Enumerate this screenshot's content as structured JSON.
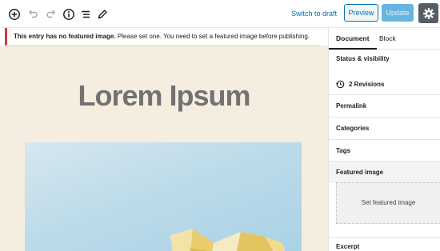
{
  "toolbar": {
    "icons": [
      "add-block-icon",
      "undo-icon",
      "redo-icon",
      "info-icon",
      "list-view-icon",
      "edit-pencil-icon"
    ],
    "switch_to_draft": "Switch to draft",
    "preview": "Preview",
    "update": "Update",
    "settings_icon": "gear-icon"
  },
  "notice": {
    "strong": "This entry has no featured image.",
    "text": " Please set one. You need to set a featured image before publishing."
  },
  "editor": {
    "title": "Lorem Ipsum",
    "background_color": "#f5eee0",
    "title_color": "#727272"
  },
  "sidebar": {
    "tabs": [
      {
        "label": "Document",
        "active": true
      },
      {
        "label": "Block",
        "active": false
      }
    ],
    "status_visibility": "Status & visibility",
    "revisions": "2 Revisions",
    "permalink": "Permalink",
    "categories": "Categories",
    "tags": "Tags",
    "featured_image": "Featured image",
    "set_featured_image": "Set featured image",
    "excerpt": "Excerpt"
  },
  "colors": {
    "accent": "#0073aa",
    "notice_border": "#d63638",
    "settings_bg": "#555d66",
    "update_bg": "#66b4e0"
  }
}
